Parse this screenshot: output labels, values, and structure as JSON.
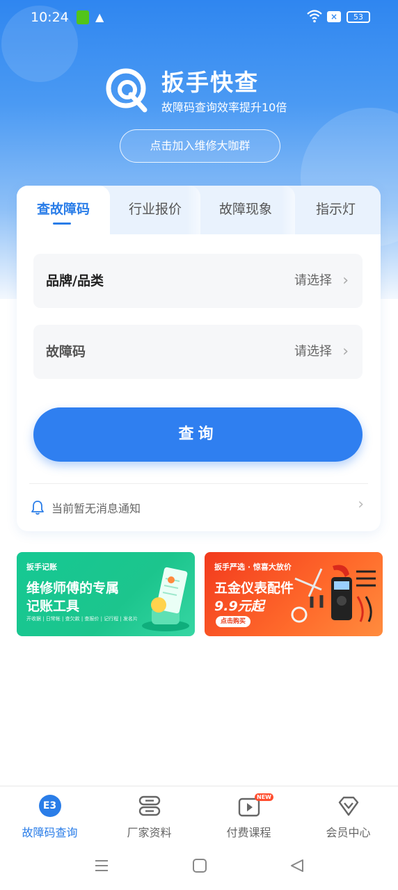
{
  "status_bar": {
    "time": "10:24",
    "battery": "53"
  },
  "header": {
    "app_name": "扳手快查",
    "slogan": "故障码查询效率提升10倍",
    "join_button": "点击加入维修大咖群"
  },
  "tabs": [
    {
      "label": "查故障码",
      "active": true
    },
    {
      "label": "行业报价",
      "active": false
    },
    {
      "label": "故障现象",
      "active": false
    },
    {
      "label": "指示灯",
      "active": false
    }
  ],
  "form": {
    "brand": {
      "label": "品牌/品类",
      "value": "请选择"
    },
    "code": {
      "label": "故障码",
      "value": "请选择"
    },
    "query_button": "查询"
  },
  "notice": {
    "text": "当前暂无消息通知"
  },
  "banners": {
    "left": {
      "tag": "扳手记账",
      "line1": "维修师傅的专属",
      "line2": "记账工具",
      "small": "开收据 | 日常帐 | 查欠款 | 查报价 | 记行程 | 发名片"
    },
    "right": {
      "tag": "扳手严选 · 惊喜大放价",
      "line1": "五金仪表配件",
      "price": "9.9元起",
      "buy": "点击购买"
    }
  },
  "bottom_nav": [
    {
      "label": "故障码查询",
      "icon": "e3-icon",
      "icon_text": "E3",
      "active": true
    },
    {
      "label": "厂家资料",
      "icon": "database-icon",
      "active": false
    },
    {
      "label": "付费课程",
      "icon": "video-course-icon",
      "badge": "NEW",
      "active": false
    },
    {
      "label": "会员中心",
      "icon": "vip-diamond-icon",
      "active": false
    }
  ],
  "colors": {
    "primary": "#2a7de8",
    "hero": "#2f86f0",
    "green": "#16c893",
    "orange": "#f23a1d"
  }
}
